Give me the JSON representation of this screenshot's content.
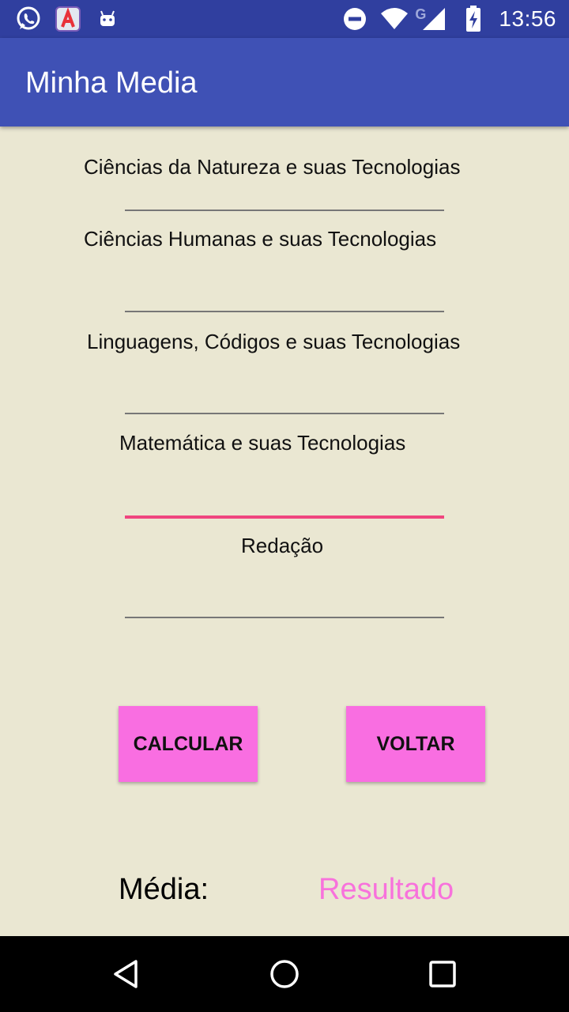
{
  "status_bar": {
    "time": "13:56",
    "network_label": "G",
    "icons": [
      "whatsapp-icon",
      "app-store-icon",
      "android-icon",
      "do-not-disturb-icon",
      "wifi-icon",
      "signal-icon",
      "battery-charging-icon"
    ]
  },
  "app_bar": {
    "title": "Minha Media",
    "color": "#3F51B5"
  },
  "form": {
    "fields": [
      {
        "label": "Ciências da Natureza e suas Tecnologias",
        "value": ""
      },
      {
        "label": "Ciências Humanas e suas Tecnologias",
        "value": ""
      },
      {
        "label": "Linguagens, Códigos e suas Tecnologias",
        "value": ""
      },
      {
        "label": "Matemática e suas Tecnologias",
        "value": ""
      },
      {
        "label": "Redação",
        "value": ""
      }
    ],
    "focused_field": "Matemática e suas Tecnologias",
    "accent_color": "#F0457F"
  },
  "buttons": {
    "calcular": "CALCULAR",
    "voltar": "VOLTAR",
    "color": "#F96EE1"
  },
  "result": {
    "label": "Média:",
    "value": "Resultado",
    "value_color": "#F872DC"
  },
  "nav_bar": {
    "icons": [
      "back-icon",
      "home-icon",
      "recents-icon"
    ]
  }
}
